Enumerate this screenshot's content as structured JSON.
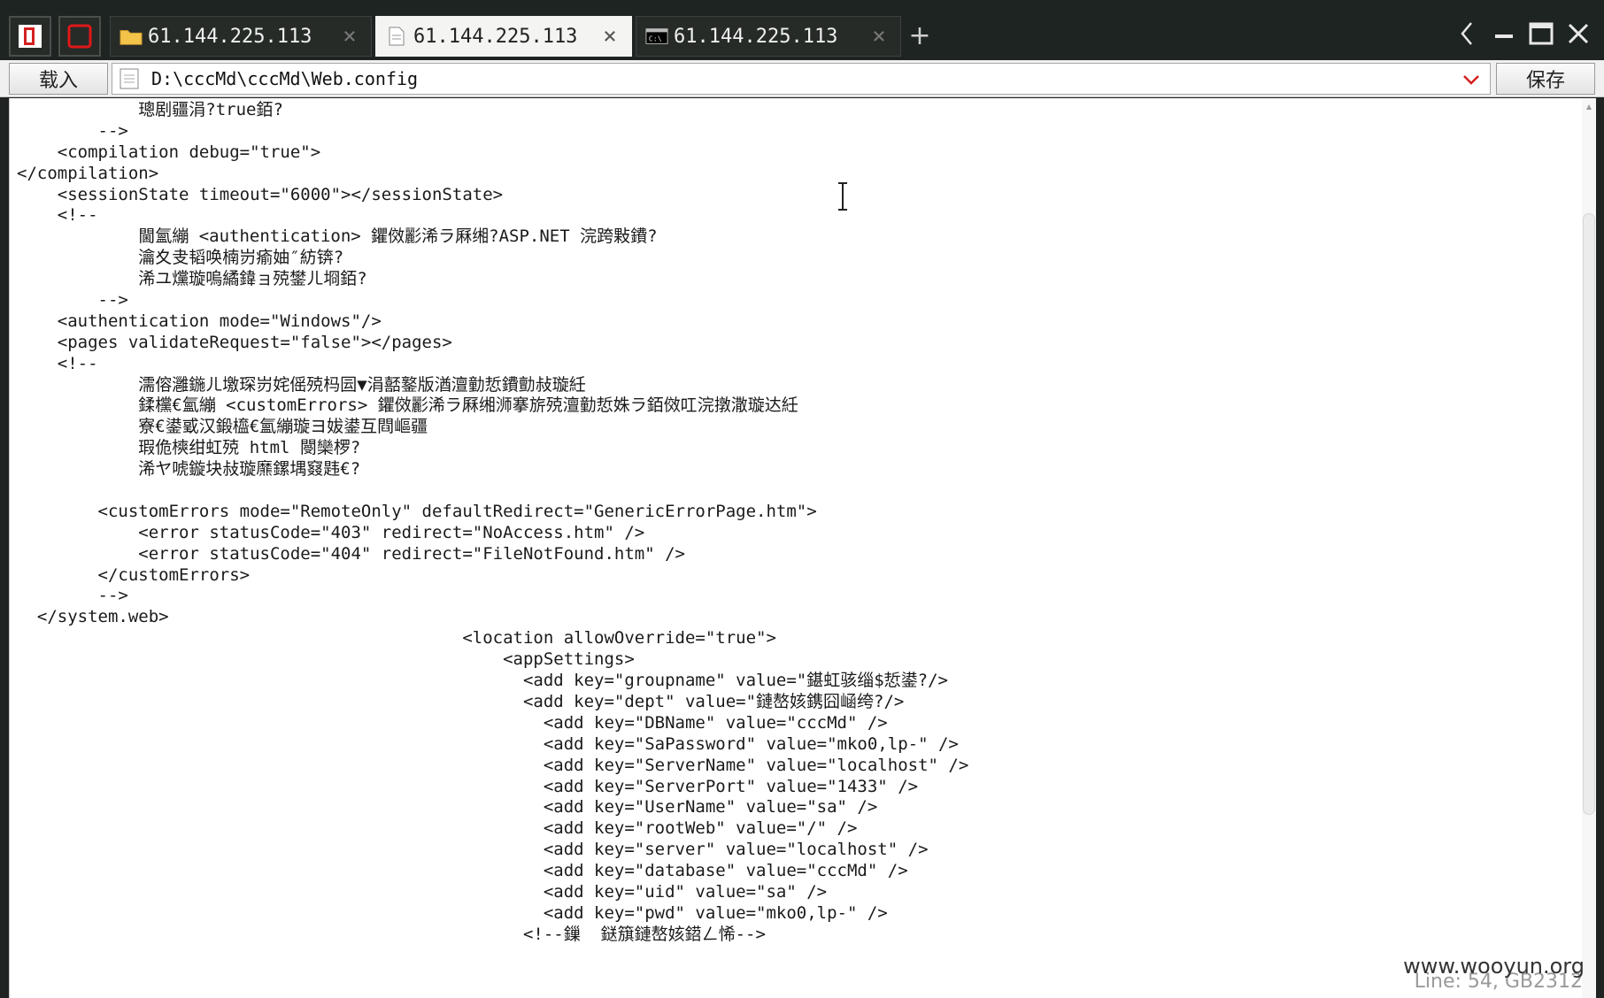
{
  "tabs": [
    {
      "label": "61.144.225.113",
      "icon": "folder-icon",
      "active": false
    },
    {
      "label": "61.144.225.113",
      "icon": "document-icon",
      "active": true
    },
    {
      "label": "61.144.225.113",
      "icon": "terminal-icon",
      "active": false
    }
  ],
  "toolbar": {
    "load_label": "载入",
    "path": "D:\\cccMd\\cccMd\\Web.config",
    "save_label": "保存"
  },
  "editor": {
    "lines": [
      "            璁剧疆涓?true銆?",
      "        -->",
      "    <compilation debug=\"true\">",
      "</compilation>",
      "    <sessionState timeout=\"6000\"></sessionState>",
      "    <!--",
      "            閫氳繃 <authentication> 鑺傚彲浠ラ厤缃?ASP.NET 浣跨敤鐨?",
      "            瀹夊叏韬唤楠岃瘉妯″紡锛?",
      "            浠ユ爣璇嗚繘鍏ョ殑鐢ㄦ埛銆?",
      "        -->",
      "    <authentication mode=\"Windows\"/>",
      "    <pages validateRequest=\"false\"></pages>",
      "    <!--",
      "            濡傛灉鍦ㄦ墽琛岃姹傜殑杩囩▼涓嚭鐜版湭澶勭悊鐨勯敊璇紝",
      "            鍒欓€氳繃 <customErrors> 鑺傚彲浠ラ厤缃浉搴旂殑澶勭悊姝ラ銆傚叿浣撴潵璇达紝",
      "            寮€鍙戜汉鍛橀€氳繃璇ヨ妭鍙互閰嶇疆",
      "            瑕佹樉绀虹殑 html 閿欒椤?",
      "            浠ヤ唬鏇块敊璇爢鏍堣窡韪€?",
      "",
      "        <customErrors mode=\"RemoteOnly\" defaultRedirect=\"GenericErrorPage.htm\">",
      "            <error statusCode=\"403\" redirect=\"NoAccess.htm\" />",
      "            <error statusCode=\"404\" redirect=\"FileNotFound.htm\" />",
      "        </customErrors>",
      "        -->",
      "  </system.web>",
      "                                            <location allowOverride=\"true\">",
      "                                                <appSettings>",
      "                                                  <add key=\"groupname\" value=\"鍖虹骇缁$悊鍙?/>",
      "                                                  <add key=\"dept\" value=\"鏈嶅姟鎸囧崡绔?/>",
      "                                                    <add key=\"DBName\" value=\"cccMd\" />",
      "                                                    <add key=\"SaPassword\" value=\"mko0,lp-\" />",
      "                                                    <add key=\"ServerName\" value=\"localhost\" />",
      "                                                    <add key=\"ServerPort\" value=\"1433\" />",
      "                                                    <add key=\"UserName\" value=\"sa\" />",
      "                                                    <add key=\"rootWeb\" value=\"/\" />",
      "                                                    <add key=\"server\" value=\"localhost\" />",
      "                                                    <add key=\"database\" value=\"cccMd\" />",
      "                                                    <add key=\"uid\" value=\"sa\" />",
      "                                                    <add key=\"pwd\" value=\"mko0,lp-\" />",
      "                                                  <!--鏁  鎹簱鏈嶅姟鍣ㄥ悕-->"
    ]
  },
  "status": "Line: 54, GB2312",
  "watermark": "www.wooyun.org"
}
